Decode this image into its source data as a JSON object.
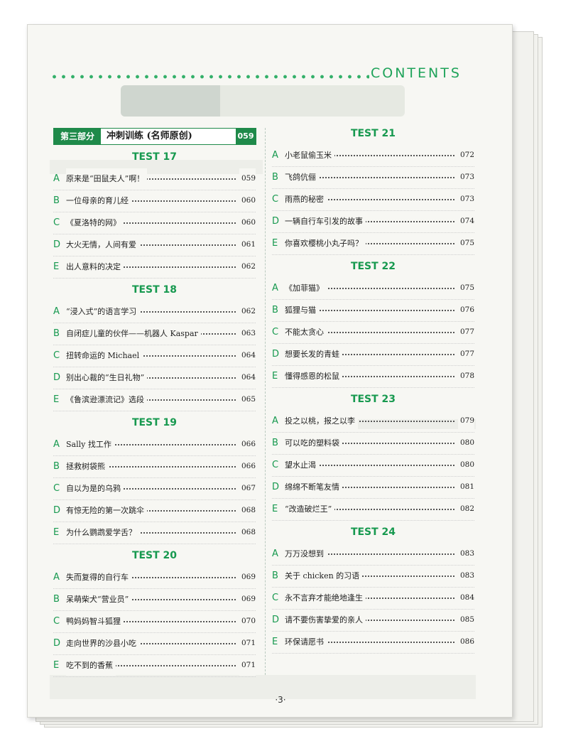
{
  "header": {
    "title": "CONTENTS"
  },
  "section": {
    "tag": "第三部分",
    "title": "冲刺训练 (名师原创)",
    "page": "059"
  },
  "left_column": [
    {
      "heading": "TEST 17",
      "entries": [
        {
          "letter": "A",
          "title": "原来是“田鼠夫人”啊！",
          "page": "059"
        },
        {
          "letter": "B",
          "title": "一位母亲的育儿经",
          "page": "060"
        },
        {
          "letter": "C",
          "title": "《夏洛特的网》",
          "page": "060"
        },
        {
          "letter": "D",
          "title": "大火无情，人间有爱",
          "page": "061"
        },
        {
          "letter": "E",
          "title": "出人意料的决定",
          "page": "062"
        }
      ]
    },
    {
      "heading": "TEST 18",
      "entries": [
        {
          "letter": "A",
          "title": "“浸入式”的语言学习",
          "page": "062"
        },
        {
          "letter": "B",
          "title": "自闭症儿童的伙伴——机器人 Kaspar",
          "page": "063"
        },
        {
          "letter": "C",
          "title": "扭转命运的 Michael",
          "page": "064"
        },
        {
          "letter": "D",
          "title": "别出心裁的“生日礼物”",
          "page": "064"
        },
        {
          "letter": "E",
          "title": "《鲁滨逊漂流记》选段",
          "page": "065"
        }
      ]
    },
    {
      "heading": "TEST 19",
      "entries": [
        {
          "letter": "A",
          "title": "Sally 找工作",
          "page": "066"
        },
        {
          "letter": "B",
          "title": "拯救树袋熊",
          "page": "066"
        },
        {
          "letter": "C",
          "title": "自以为是的乌鸦",
          "page": "067"
        },
        {
          "letter": "D",
          "title": "有惊无险的第一次跳伞",
          "page": "068"
        },
        {
          "letter": "E",
          "title": "为什么鹦鹉爱学舌？",
          "page": "068"
        }
      ]
    },
    {
      "heading": "TEST 20",
      "entries": [
        {
          "letter": "A",
          "title": "失而复得的自行车",
          "page": "069"
        },
        {
          "letter": "B",
          "title": "呆萌柴犬“营业员”",
          "page": "069"
        },
        {
          "letter": "C",
          "title": "鸭妈妈智斗狐狸",
          "page": "070"
        },
        {
          "letter": "D",
          "title": "走向世界的沙县小吃",
          "page": "071"
        },
        {
          "letter": "E",
          "title": "吃不到的香蕉",
          "page": "071"
        }
      ]
    }
  ],
  "right_column": [
    {
      "heading": "TEST 21",
      "entries": [
        {
          "letter": "A",
          "title": "小老鼠偷玉米",
          "page": "072"
        },
        {
          "letter": "B",
          "title": "飞鸽伉俪",
          "page": "073"
        },
        {
          "letter": "C",
          "title": "雨燕的秘密",
          "page": "073"
        },
        {
          "letter": "D",
          "title": "一辆自行车引发的故事",
          "page": "074"
        },
        {
          "letter": "E",
          "title": "你喜欢樱桃小丸子吗？",
          "page": "075"
        }
      ]
    },
    {
      "heading": "TEST 22",
      "entries": [
        {
          "letter": "A",
          "title": "《加菲猫》",
          "page": "075"
        },
        {
          "letter": "B",
          "title": "狐狸与猫",
          "page": "076"
        },
        {
          "letter": "C",
          "title": "不能太贪心",
          "page": "077"
        },
        {
          "letter": "D",
          "title": "想要长发的青蛙",
          "page": "077"
        },
        {
          "letter": "E",
          "title": "懂得感恩的松鼠",
          "page": "078"
        }
      ]
    },
    {
      "heading": "TEST 23",
      "entries": [
        {
          "letter": "A",
          "title": "投之以桃，报之以李",
          "page": "079"
        },
        {
          "letter": "B",
          "title": "可以吃的塑料袋",
          "page": "080"
        },
        {
          "letter": "C",
          "title": "望水止渴",
          "page": "080"
        },
        {
          "letter": "D",
          "title": "绵绵不断笔友情",
          "page": "081"
        },
        {
          "letter": "E",
          "title": "“改造破烂王”",
          "page": "082"
        }
      ]
    },
    {
      "heading": "TEST 24",
      "entries": [
        {
          "letter": "A",
          "title": "万万没想到",
          "page": "083"
        },
        {
          "letter": "B",
          "title": "关于 chicken 的习语",
          "page": "083"
        },
        {
          "letter": "C",
          "title": "永不言弃才能绝地逢生",
          "page": "084"
        },
        {
          "letter": "D",
          "title": "请不要伤害挚爱的亲人",
          "page": "085"
        },
        {
          "letter": "E",
          "title": "环保请愿书",
          "page": "086"
        }
      ]
    }
  ],
  "footer": {
    "page_number": "·3·"
  },
  "colors": {
    "accent": "#17994f",
    "section_bg": "#1f8a4a"
  }
}
